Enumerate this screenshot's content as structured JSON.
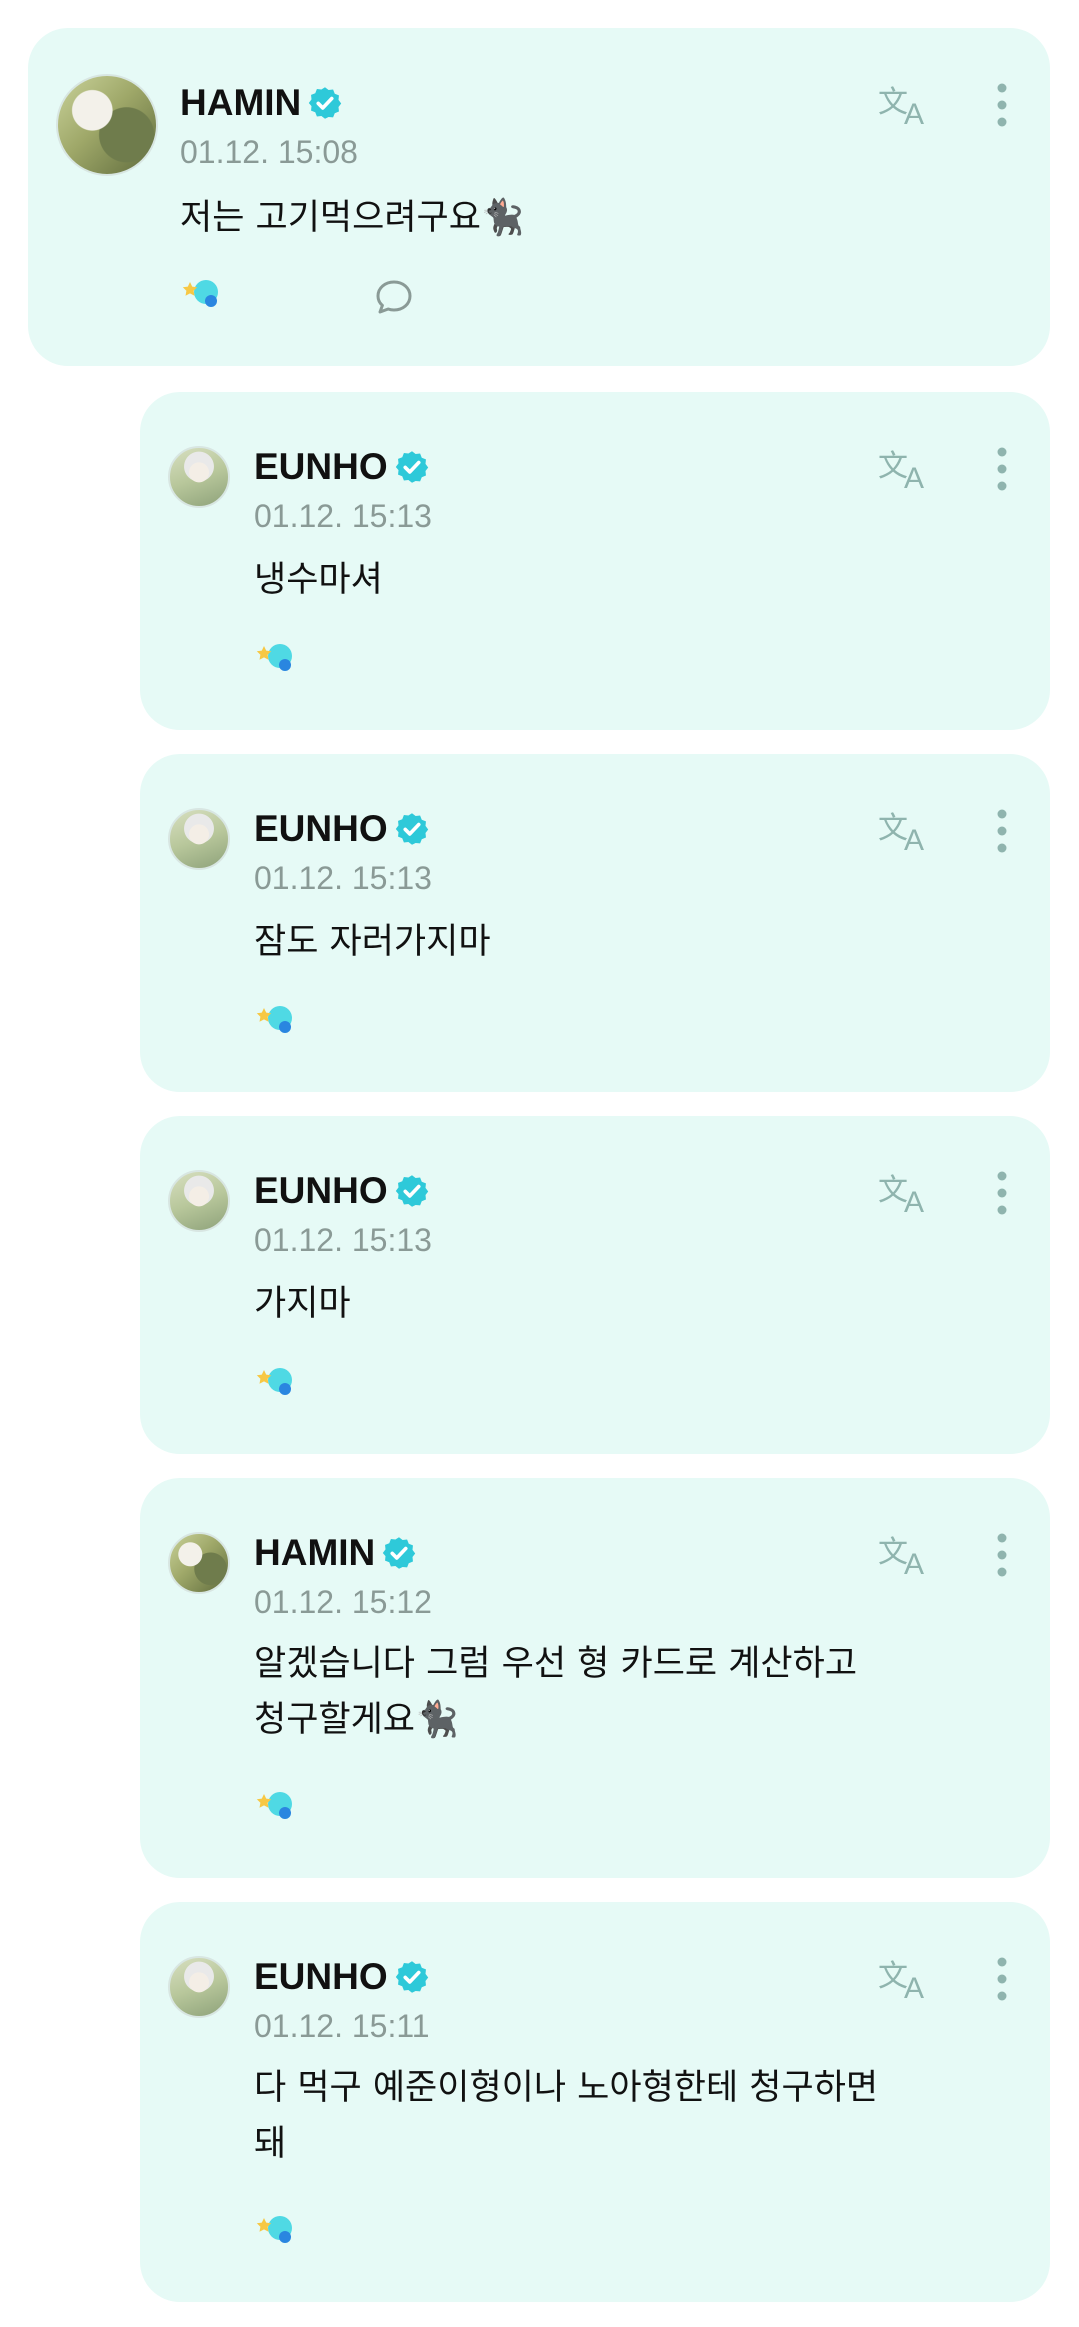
{
  "posts": [
    {
      "author": "HAMIN",
      "timestamp": "01.12. 15:08",
      "message": "저는 고기먹으려구요🐈‍⬛"
    },
    {
      "author": "EUNHO",
      "timestamp": "01.12. 15:13",
      "message": "냉수마셔"
    },
    {
      "author": "EUNHO",
      "timestamp": "01.12. 15:13",
      "message": "잠도 자러가지마"
    },
    {
      "author": "EUNHO",
      "timestamp": "01.12. 15:13",
      "message": "가지마"
    },
    {
      "author": "HAMIN",
      "timestamp": "01.12. 15:12",
      "message": "알겠습니다 그럼 우선 형 카드로 계산하고\n청구할게요🐈‍⬛"
    },
    {
      "author": "EUNHO",
      "timestamp": "01.12. 15:11",
      "message": "다 먹구 예준이형이나 노아형한테 청구하면\n돼"
    }
  ],
  "icons": {
    "verified": "verified-badge-icon",
    "translate": "translate-icon",
    "more": "more-vertical-icon",
    "reaction": "reaction-icon",
    "comment": "comment-icon"
  },
  "colors": {
    "card_background": "#e6faf6",
    "accent": "#2ec9d9",
    "muted_icon": "#8fb4ae"
  }
}
